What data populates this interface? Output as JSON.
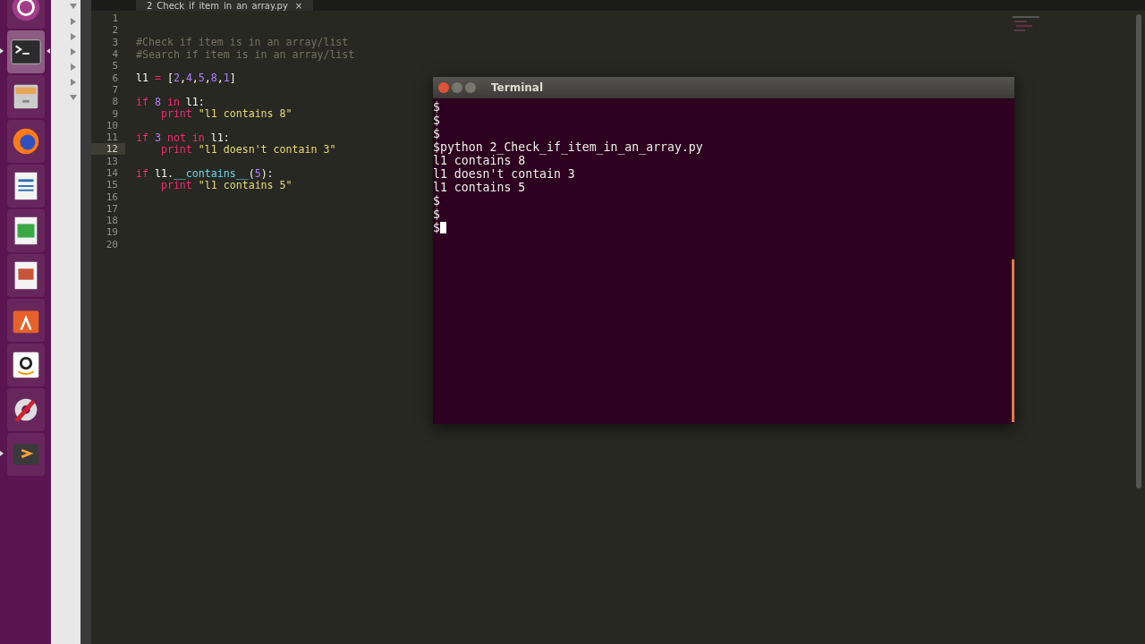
{
  "launcher": [
    {
      "kind": "ubuntu",
      "running": false,
      "selected": false
    },
    {
      "kind": "terminal",
      "running": true,
      "selected": true
    },
    {
      "kind": "files",
      "running": false,
      "selected": false
    },
    {
      "kind": "firefox",
      "running": false,
      "selected": false
    },
    {
      "kind": "writer",
      "running": false,
      "selected": false
    },
    {
      "kind": "calc",
      "running": false,
      "selected": false
    },
    {
      "kind": "impress",
      "running": false,
      "selected": false
    },
    {
      "kind": "software",
      "running": false,
      "selected": false
    },
    {
      "kind": "amazon",
      "running": false,
      "selected": false
    },
    {
      "kind": "settings",
      "running": false,
      "selected": false
    },
    {
      "kind": "sublime",
      "running": true,
      "selected": false
    }
  ],
  "sidebar": {
    "nodes": [
      {
        "expanded": true
      },
      {
        "expanded": false
      },
      {
        "expanded": false
      },
      {
        "expanded": false
      },
      {
        "expanded": false
      },
      {
        "expanded": false
      },
      {
        "expanded": true
      }
    ]
  },
  "editor": {
    "tab": {
      "label": "2_Check_if_item_in_an_array.py",
      "close": "×"
    },
    "lines": [
      {
        "number": "1",
        "current": false
      },
      {
        "number": "2",
        "current": false
      },
      {
        "number": "3",
        "current": false,
        "tokens": [
          {
            "kind": "comment",
            "text": "#Check if item is in an array/list"
          }
        ]
      },
      {
        "number": "4",
        "current": false,
        "tokens": [
          {
            "kind": "comment",
            "text": "#Search if item is in an array/list"
          }
        ]
      },
      {
        "number": "5",
        "current": false
      },
      {
        "number": "6",
        "current": false,
        "tokens": [
          {
            "kind": "plain",
            "text": "l1"
          },
          {
            "kind": "keyword",
            "text": " ="
          },
          {
            "kind": "plain",
            "text": " ["
          },
          {
            "kind": "number",
            "text": "2"
          },
          {
            "kind": "plain",
            "text": ","
          },
          {
            "kind": "number",
            "text": "4"
          },
          {
            "kind": "plain",
            "text": ","
          },
          {
            "kind": "number",
            "text": "5"
          },
          {
            "kind": "plain",
            "text": ","
          },
          {
            "kind": "number",
            "text": "8"
          },
          {
            "kind": "plain",
            "text": ","
          },
          {
            "kind": "number",
            "text": "1"
          },
          {
            "kind": "plain",
            "text": "]"
          }
        ]
      },
      {
        "number": "7",
        "current": false
      },
      {
        "number": "8",
        "current": false,
        "tokens": [
          {
            "kind": "keyword",
            "text": "if"
          },
          {
            "kind": "number",
            "text": " 8"
          },
          {
            "kind": "keyword",
            "text": " in"
          },
          {
            "kind": "plain",
            "text": " l1:"
          }
        ]
      },
      {
        "number": "9",
        "current": false,
        "tokens": [
          {
            "kind": "keyword",
            "text": "    print"
          },
          {
            "kind": "string",
            "text": " \"l1 contains 8\""
          }
        ]
      },
      {
        "number": "10",
        "current": false
      },
      {
        "number": "11",
        "current": false,
        "tokens": [
          {
            "kind": "keyword",
            "text": "if"
          },
          {
            "kind": "number",
            "text": " 3"
          },
          {
            "kind": "keyword",
            "text": " not in"
          },
          {
            "kind": "plain",
            "text": " l1:"
          }
        ]
      },
      {
        "number": "12",
        "current": true,
        "tokens": [
          {
            "kind": "keyword",
            "text": "    print"
          },
          {
            "kind": "string",
            "text": " \"l1 doesn't contain 3\""
          }
        ]
      },
      {
        "number": "13",
        "current": false
      },
      {
        "number": "14",
        "current": false,
        "tokens": [
          {
            "kind": "keyword",
            "text": "if"
          },
          {
            "kind": "plain",
            "text": " l1."
          },
          {
            "kind": "function",
            "text": "__contains__"
          },
          {
            "kind": "plain",
            "text": "("
          },
          {
            "kind": "number",
            "text": "5"
          },
          {
            "kind": "plain",
            "text": "):"
          }
        ]
      },
      {
        "number": "15",
        "current": false,
        "tokens": [
          {
            "kind": "keyword",
            "text": "    print"
          },
          {
            "kind": "string",
            "text": " \"l1 contains 5\""
          }
        ]
      },
      {
        "number": "16",
        "current": false
      },
      {
        "number": "17",
        "current": false
      },
      {
        "number": "18",
        "current": false
      },
      {
        "number": "19",
        "current": false
      },
      {
        "number": "20",
        "current": false
      }
    ]
  },
  "terminal": {
    "title": "Terminal",
    "lines": [
      "$",
      "$",
      "$",
      "$python 2_Check_if_item_in_an_array.py",
      "l1 contains 8",
      "l1 doesn't contain 3",
      "l1 contains 5",
      "$",
      "$",
      "$"
    ]
  }
}
